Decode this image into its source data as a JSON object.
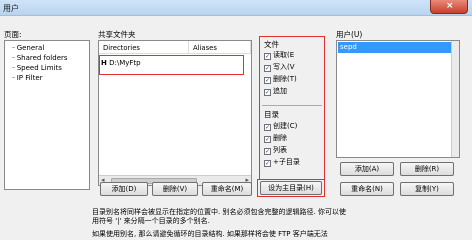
{
  "window": {
    "title": "用户",
    "close_glyph": "×"
  },
  "left_panel": {
    "label": "页面:",
    "items": [
      "General",
      "Shared folders",
      "Speed Limits",
      "IP Filter"
    ]
  },
  "shared": {
    "label": "共享文件夹",
    "columns": [
      "Directories",
      "Aliases"
    ],
    "row_marker": "H",
    "row_path": "D:\\MyFtp",
    "scroll_left": "◂",
    "scroll_right": "▸",
    "buttons": {
      "add": "添加(D)",
      "remove": "删除(V)",
      "rename": "重命名(M)",
      "set_root": "设为主目录(H)"
    }
  },
  "permissions": {
    "files_label": "文件",
    "files": [
      "读取(E",
      "写入(V",
      "删除(T)",
      "追加"
    ],
    "dirs_label": "目录",
    "dirs": [
      "创建(C)",
      "删除",
      "列表",
      "+子目录"
    ],
    "check_glyph": "✓"
  },
  "users": {
    "label": "用户(U)",
    "selected": "sepd",
    "buttons": {
      "add": "添加(A)",
      "remove": "删除(R)",
      "rename": "重命名(N)",
      "copy": "复制(Y)"
    }
  },
  "description": {
    "line1": "目录别名将同样会被显示在指定的位置中. 别名必须包含完整的逻辑路径. 你可以使",
    "line2": "用符号 '|' 来分隔一个目录的多个别名.",
    "line3": "如果使用别名, 那么请避免循环的目录结构. 如果那样将会使 FTP 客户端无法"
  }
}
